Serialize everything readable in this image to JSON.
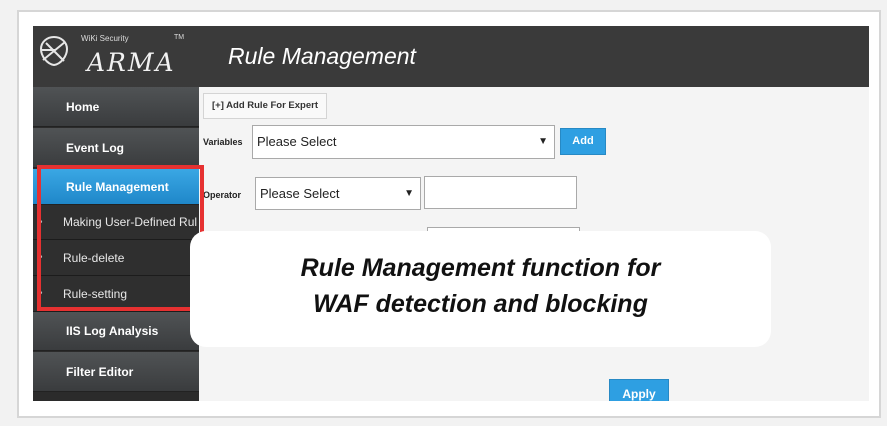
{
  "header": {
    "brand_small": "WiKi Security",
    "brand_tm": "TM",
    "brand_name": "ARMA",
    "title": "Rule Management"
  },
  "sidebar": {
    "items": [
      {
        "label": "Home"
      },
      {
        "label": "Event Log"
      },
      {
        "label": "Rule Management",
        "active": true
      },
      {
        "label": "Making User-Defined Rul"
      },
      {
        "label": "Rule-delete"
      },
      {
        "label": "Rule-setting"
      },
      {
        "label": "IIS Log Analysis"
      },
      {
        "label": "Filter Editor"
      }
    ],
    "bullet": "•"
  },
  "main": {
    "expert_button": "[+] Add Rule For Expert",
    "variables_label": "Variables",
    "variables_select": "Please Select",
    "add_button": "Add",
    "operator_label": "Operator",
    "operator_select": "Please Select",
    "apply_button": "Apply",
    "select_arrow": "▼"
  },
  "overlay": {
    "line1": "Rule Management function for",
    "line2": "WAF detection and blocking"
  },
  "colors": {
    "accent": "#2e9fe2",
    "highlight_border": "#e63131",
    "header_bg": "#3a3a3a"
  }
}
